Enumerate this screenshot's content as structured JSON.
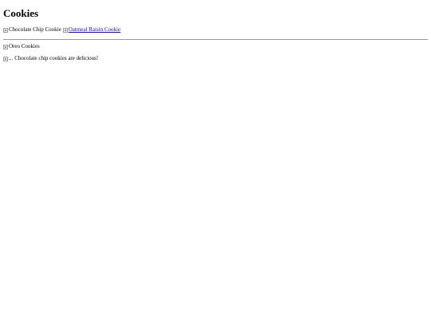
{
  "page": {
    "heading": "Cookies"
  },
  "images": {
    "chocolate_chip_alt": "Chocolate Chip Cookie",
    "oatmeal_raisin_alt": "Oatmeal Raisin Cookie",
    "oreo_alt": "Oreo Cookies",
    "ellipsis_alt": "..."
  },
  "text": {
    "chocolate_sentence": "Chocolate chip cookies are delicious!"
  },
  "colors": {
    "link": "#1a0dab",
    "rule": "#9a9a9a"
  },
  "icons": {
    "broken_image": "broken-image-icon"
  }
}
